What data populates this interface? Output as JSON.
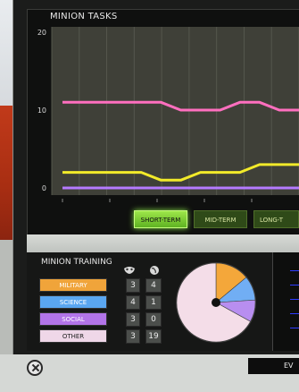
{
  "panel": {
    "title": "MINION TASKS"
  },
  "chart_data": {
    "type": "line",
    "title": "MINION TASKS",
    "yticks": [
      "20",
      "10",
      "0"
    ],
    "ylim": [
      0,
      20
    ],
    "series": [
      {
        "name": "",
        "color": "#ff6fbf",
        "values": [
          11,
          11,
          11,
          11,
          11,
          11,
          10,
          10,
          10,
          11,
          11,
          10,
          10
        ]
      },
      {
        "name": "",
        "color": "#f2ea2a",
        "values": [
          2,
          2,
          2,
          2,
          2,
          1,
          1,
          2,
          2,
          2,
          3,
          3,
          3
        ]
      },
      {
        "name": "",
        "color": "#b57aff",
        "values": [
          0,
          0,
          0,
          0,
          0,
          0,
          0,
          0,
          0,
          0,
          0,
          0,
          0
        ]
      }
    ]
  },
  "tabs": [
    {
      "label": "SHORT-TERM",
      "active": true
    },
    {
      "label": "MID-TERM",
      "active": false
    },
    {
      "label": "LONG-T",
      "active": false
    }
  ],
  "training": {
    "title": "MINION TRAINING",
    "header_icons": [
      "mask-icon",
      "globe-icon"
    ],
    "rows": [
      {
        "label": "MILITARY",
        "color": "#f0a43a",
        "v1": "3",
        "v2": "4"
      },
      {
        "label": "SCIENCE",
        "color": "#5aa6f0",
        "v1": "4",
        "v2": "1"
      },
      {
        "label": "SOCIAL",
        "color": "#b274e8",
        "v1": "3",
        "v2": "0"
      },
      {
        "label": "OTHER",
        "color": "#efd7e8",
        "v1": "3",
        "v2": "19"
      }
    ],
    "pie": [
      {
        "label": "MILITARY",
        "value": 0.14,
        "color": "#f4a73a"
      },
      {
        "label": "SCIENCE",
        "value": 0.1,
        "color": "#71aef4"
      },
      {
        "label": "SOCIAL",
        "value": 0.09,
        "color": "#b88ef0"
      },
      {
        "label": "OTHER",
        "value": 0.67,
        "color": "#f4dde8"
      }
    ]
  },
  "footer": {
    "button_label": "E​V"
  }
}
